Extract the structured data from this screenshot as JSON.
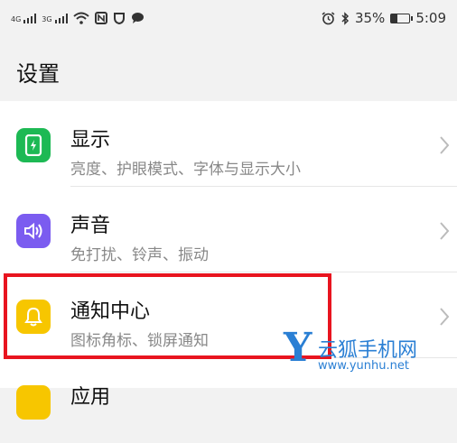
{
  "status_bar": {
    "network_1": "4G",
    "network_2": "3G",
    "battery_percent_text": "35%",
    "battery_level": 0.35,
    "time": "5:09"
  },
  "header": {
    "title": "设置"
  },
  "items": [
    {
      "title": "显示",
      "subtitle": "亮度、护眼模式、字体与显示大小",
      "icon": "display-icon",
      "icon_color": "#1db954"
    },
    {
      "title": "声音",
      "subtitle": "免打扰、铃声、振动",
      "icon": "sound-icon",
      "icon_color": "#7b5cf0"
    },
    {
      "title": "通知中心",
      "subtitle": "图标角标、锁屏通知",
      "icon": "bell-icon",
      "icon_color": "#f7c600"
    },
    {
      "title": "应用",
      "subtitle": "",
      "icon": "apps-icon",
      "icon_color": "#f7c600"
    }
  ],
  "highlight_color": "#e8141f",
  "watermark": {
    "letter": "Y",
    "brand": "云狐手机网",
    "url": "www.yunhu.net",
    "color": "#2a7fd4"
  }
}
